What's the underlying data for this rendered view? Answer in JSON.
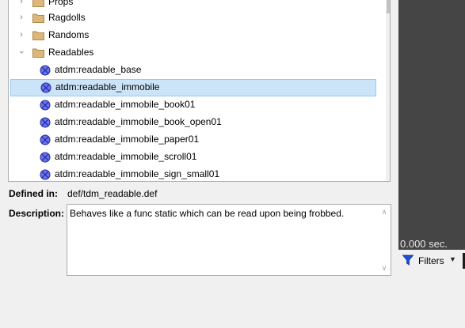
{
  "tree": {
    "folders": [
      {
        "label": "Props",
        "expanded": false
      },
      {
        "label": "Ragdolls",
        "expanded": false
      },
      {
        "label": "Randoms",
        "expanded": false
      },
      {
        "label": "Readables",
        "expanded": true
      }
    ],
    "items": [
      {
        "label": "atdm:readable_base",
        "selected": false
      },
      {
        "label": "atdm:readable_immobile",
        "selected": true
      },
      {
        "label": "atdm:readable_immobile_book01",
        "selected": false
      },
      {
        "label": "atdm:readable_immobile_book_open01",
        "selected": false
      },
      {
        "label": "atdm:readable_immobile_paper01",
        "selected": false
      },
      {
        "label": "atdm:readable_immobile_scroll01",
        "selected": false
      },
      {
        "label": "atdm:readable_immobile_sign_small01",
        "selected": false
      }
    ]
  },
  "details": {
    "defined_in_label": "Defined in:",
    "defined_in_value": "def/tdm_readable.def",
    "description_label": "Description:",
    "description_value": "Behaves like a func static which can be read upon being frobbed."
  },
  "preview": {
    "time_text": "0.000 sec."
  },
  "toolbar": {
    "filters_label": "Filters"
  },
  "colors": {
    "selection": "#cce4f7",
    "folder": "#dcb67a",
    "entity_icon": "#3b47d6",
    "preview_bg": "#454545",
    "funnel": "#1e4fd6"
  }
}
